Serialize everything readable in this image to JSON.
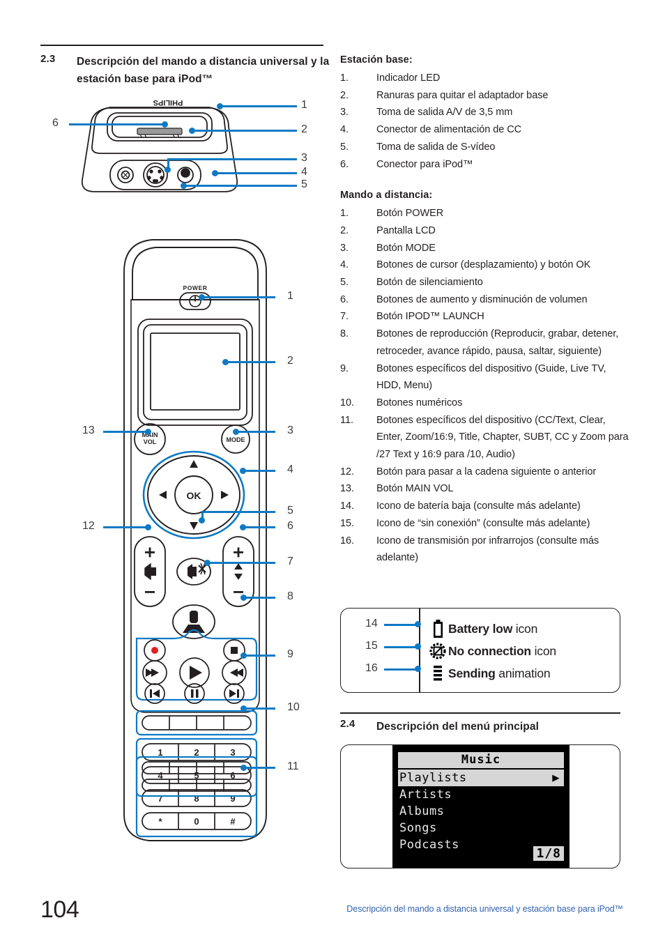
{
  "section_23": {
    "number": "2.3",
    "title": "Descripción del mando a distancia universal y la estación base para iPod™"
  },
  "base_station": {
    "heading": "Estación base:",
    "items": [
      {
        "n": "1.",
        "text": "Indicador LED"
      },
      {
        "n": "2.",
        "text": "Ranuras para quitar el adaptador base"
      },
      {
        "n": "3.",
        "text": "Toma de salida A/V de 3,5 mm"
      },
      {
        "n": "4.",
        "text": "Conector de alimentación de CC"
      },
      {
        "n": "5.",
        "text": "Toma de salida de S-vídeo"
      },
      {
        "n": "6.",
        "text": "Conector para iPod™"
      }
    ]
  },
  "remote": {
    "heading": "Mando a distancia:",
    "items": [
      {
        "n": "1.",
        "text": "Botón POWER"
      },
      {
        "n": "2.",
        "text": "Pantalla LCD"
      },
      {
        "n": "3.",
        "text": "Botón MODE"
      },
      {
        "n": "4.",
        "text": "Botones de cursor (desplazamiento) y botón OK"
      },
      {
        "n": "5.",
        "text": "Botón de silenciamiento"
      },
      {
        "n": "6.",
        "text": "Botones de aumento y disminución de volumen"
      },
      {
        "n": "7.",
        "text": "Botón IPOD™ LAUNCH"
      },
      {
        "n": "8.",
        "text": "Botones de reproducción (Reproducir, grabar, detener, retroceder, avance rápido, pausa, saltar, siguiente)"
      },
      {
        "n": "9.",
        "text": "Botones específicos del dispositivo (Guide, Live TV, HDD, Menu)"
      },
      {
        "n": "10.",
        "text": "Botones numéricos"
      },
      {
        "n": "11.",
        "text": "Botones específicos del dispositivo (CC/Text, Clear, Enter, Zoom/16:9, Title, Chapter, SUBT, CC y Zoom para /27 Text y 16:9 para /10, Audio)"
      },
      {
        "n": "12.",
        "text": "Botón para pasar a la cadena siguiente o anterior"
      },
      {
        "n": "13.",
        "text": "Botón MAIN VOL"
      },
      {
        "n": "14.",
        "text": "Icono de batería baja (consulte más adelante)"
      },
      {
        "n": "15.",
        "text": "Icono de “sin conexión” (consulte más adelante)"
      },
      {
        "n": "16.",
        "text": "Icono de transmisión por infrarrojos (consulte más adelante)"
      }
    ]
  },
  "base_art": {
    "brand": "PHILIPS",
    "callouts": [
      {
        "label": "1"
      },
      {
        "label": "2"
      },
      {
        "label": "3"
      },
      {
        "label": "4"
      },
      {
        "label": "5"
      },
      {
        "label": "6"
      }
    ]
  },
  "remote_art": {
    "power_label": "POWER",
    "main_vol_label_1": "MAIN",
    "main_vol_label_2": "VOL",
    "mode_label": "MODE",
    "ok_label": "OK",
    "keypad": [
      [
        "1",
        "2",
        "3"
      ],
      [
        "4",
        "5",
        "6"
      ],
      [
        "7",
        "8",
        "9"
      ],
      [
        "*",
        "0",
        "#"
      ]
    ],
    "callouts": [
      {
        "label": "1"
      },
      {
        "label": "2"
      },
      {
        "label": "3"
      },
      {
        "label": "4"
      },
      {
        "label": "5"
      },
      {
        "label": "6"
      },
      {
        "label": "7"
      },
      {
        "label": "8"
      },
      {
        "label": "9"
      },
      {
        "label": "10"
      },
      {
        "label": "11"
      },
      {
        "label": "12"
      },
      {
        "label": "13"
      }
    ]
  },
  "icon_legend": {
    "rows": [
      {
        "callout": "14",
        "icon": "battery-low-icon",
        "bold": "Battery low",
        "rest": " icon"
      },
      {
        "callout": "15",
        "icon": "no-connection-icon",
        "bold": "No connection",
        "rest": " icon"
      },
      {
        "callout": "16",
        "icon": "sending-animation-icon",
        "bold": "Sending",
        "rest": " animation"
      }
    ]
  },
  "section_24": {
    "number": "2.4",
    "title": "Descripción del menú principal"
  },
  "lcd_menu": {
    "title": "Music",
    "items": [
      "Playlists",
      "Artists",
      "Albums",
      "Songs",
      "Podcasts"
    ],
    "selected_index": 0,
    "selected_arrow": "▶",
    "page_indicator": "1/8"
  },
  "footer": {
    "page_number": "104",
    "text": "Descripción del mando a distancia universal y estación base para iPod™"
  },
  "colors": {
    "callout_blue": "#0e7ac4",
    "footer_blue": "#3262b0",
    "ink": "#231f20"
  }
}
